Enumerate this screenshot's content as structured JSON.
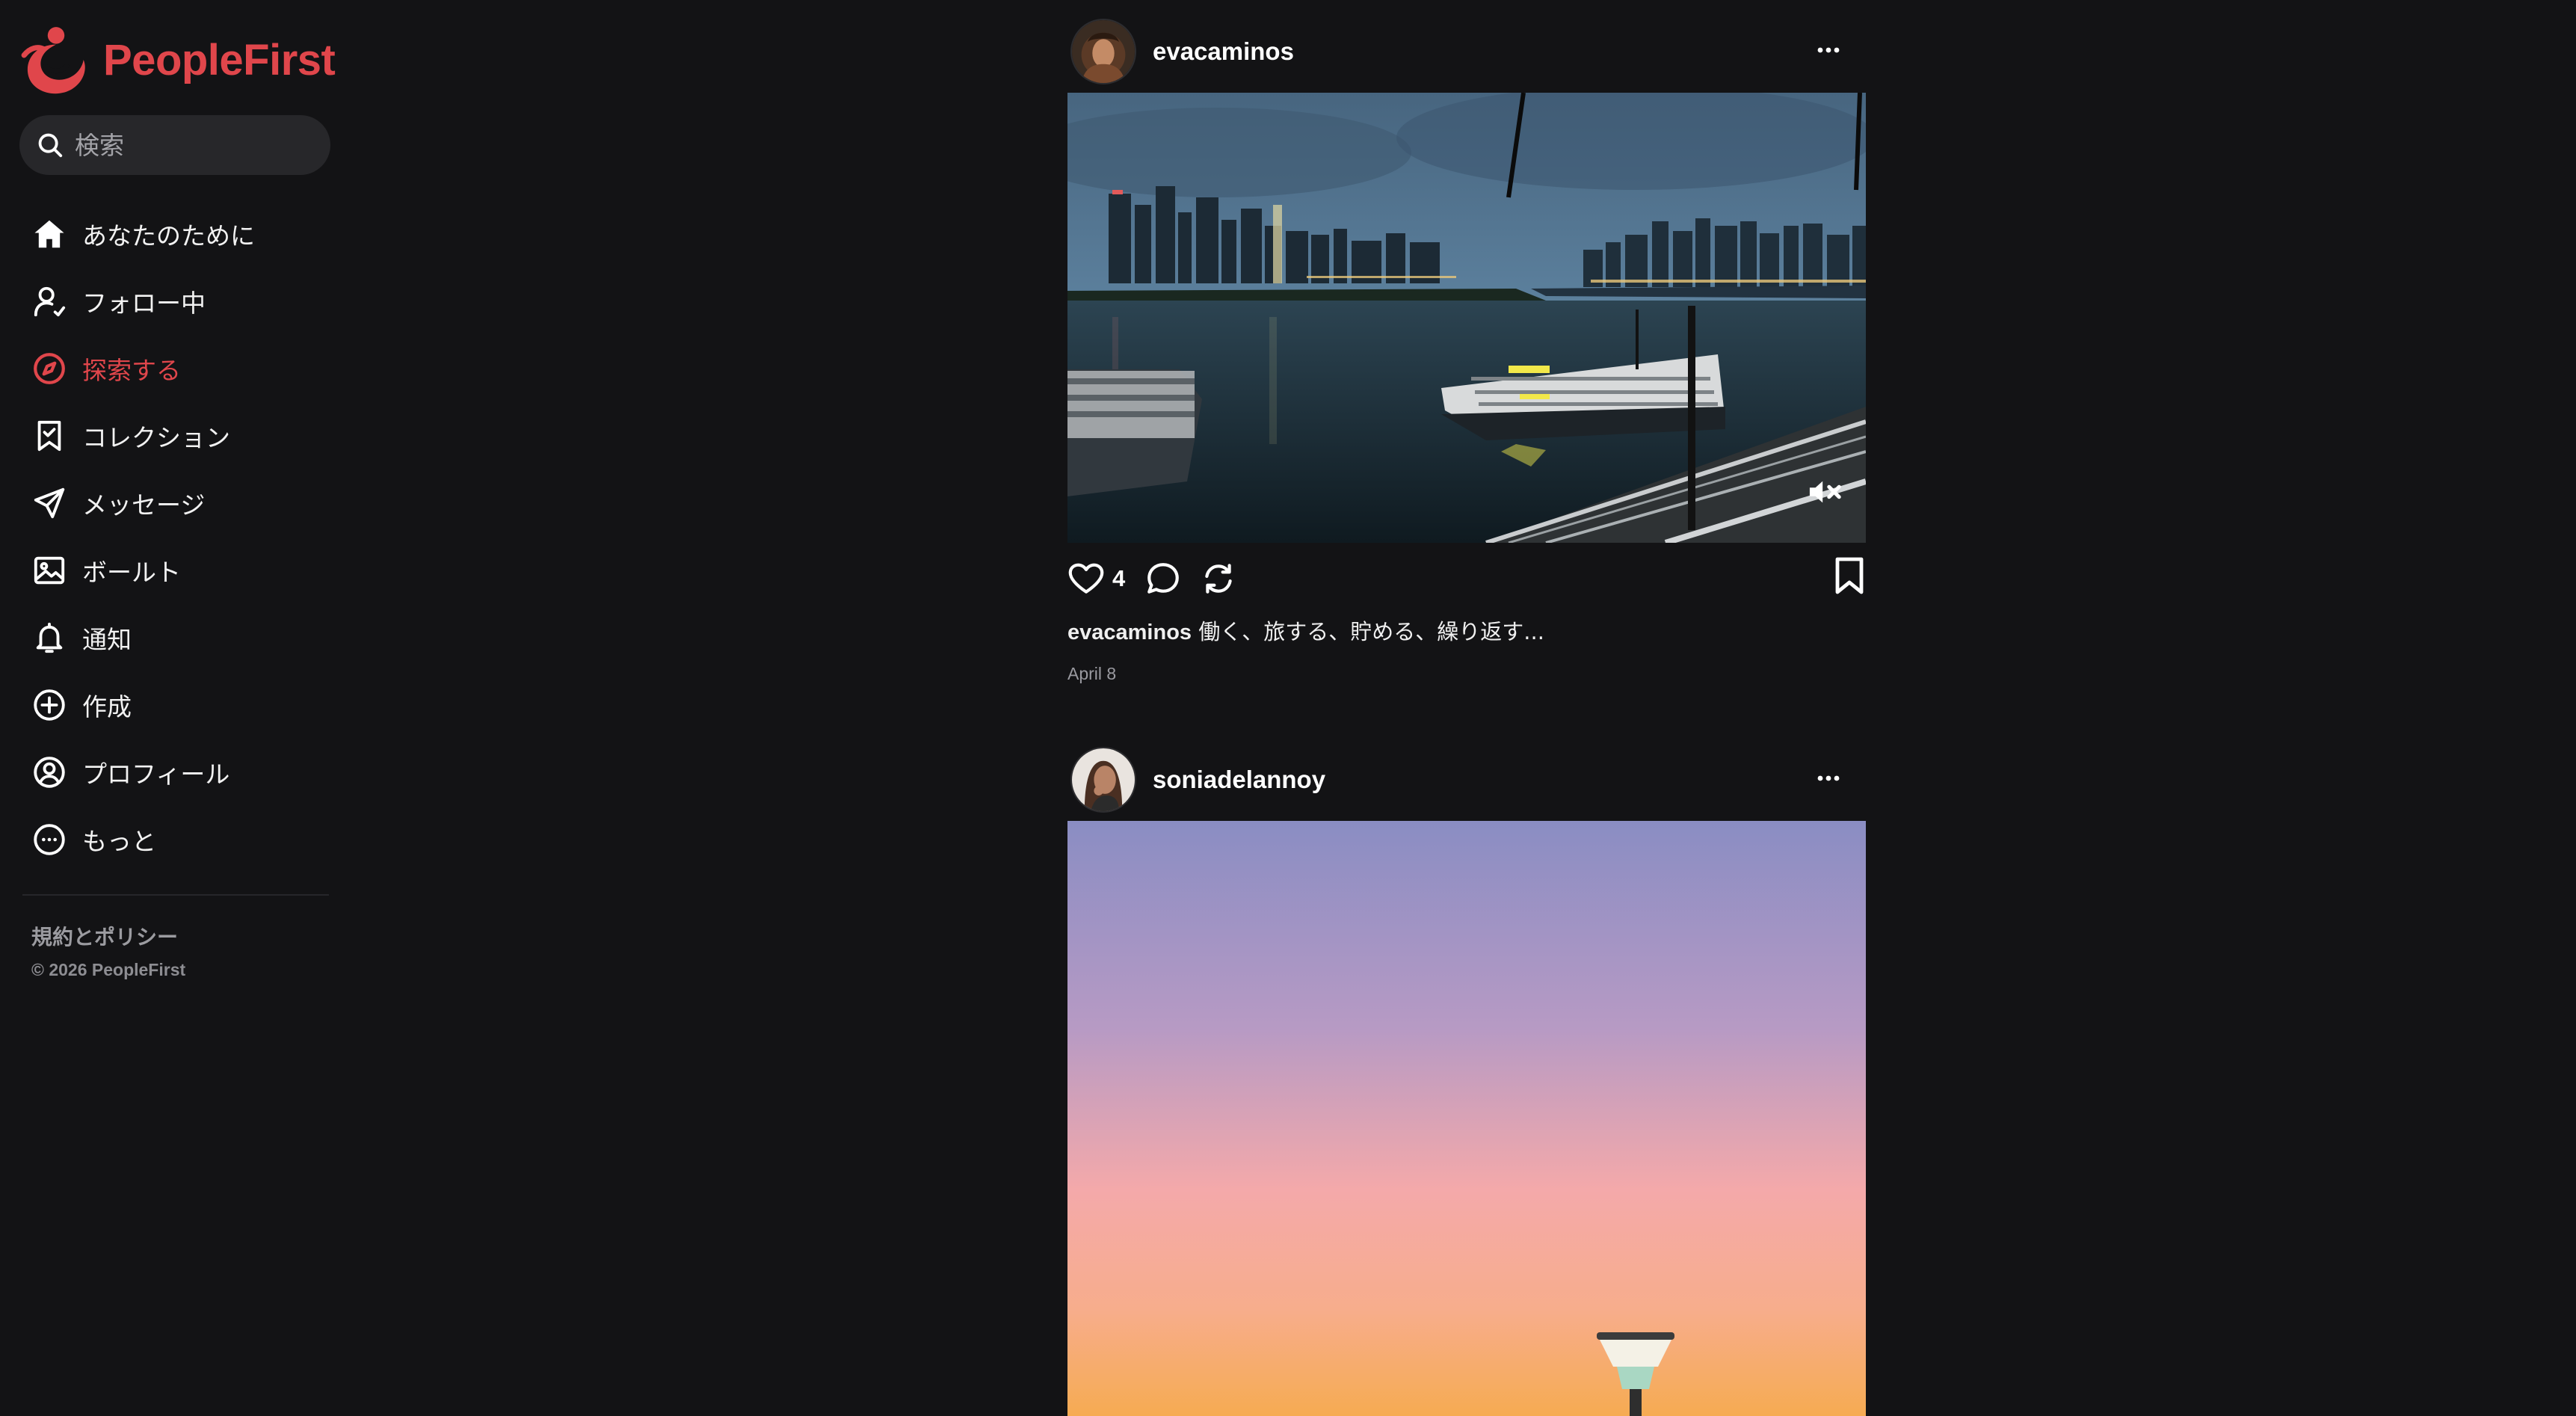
{
  "brand": {
    "name": "PeopleFirst",
    "accent": "#e0464b"
  },
  "search": {
    "placeholder": "検索"
  },
  "nav": {
    "items": [
      {
        "label": "あなたのために",
        "icon": "home-icon",
        "active": false
      },
      {
        "label": "フォロー中",
        "icon": "user-follow-icon",
        "active": false
      },
      {
        "label": "探索する",
        "icon": "compass-icon",
        "active": true
      },
      {
        "label": "コレクション",
        "icon": "bookmark-check-icon",
        "active": false
      },
      {
        "label": "メッセージ",
        "icon": "send-icon",
        "active": false
      },
      {
        "label": "ボールト",
        "icon": "image-icon",
        "active": false
      },
      {
        "label": "通知",
        "icon": "bell-icon",
        "active": false
      },
      {
        "label": "作成",
        "icon": "plus-circle-icon",
        "active": false
      },
      {
        "label": "プロフィール",
        "icon": "profile-icon",
        "active": false
      },
      {
        "label": "もっと",
        "icon": "more-circle-icon",
        "active": false
      }
    ]
  },
  "footer": {
    "terms": "規約とポリシー",
    "copyright": "© 2026 PeopleFirst"
  },
  "posts": [
    {
      "username": "evacaminos",
      "likes": "4",
      "caption_user": "evacaminos",
      "caption": "働く、旅する、貯める、繰り返す...",
      "date": "April 8",
      "media_type": "video",
      "muted": true
    },
    {
      "username": "soniadelannoy",
      "media_type": "image"
    }
  ]
}
